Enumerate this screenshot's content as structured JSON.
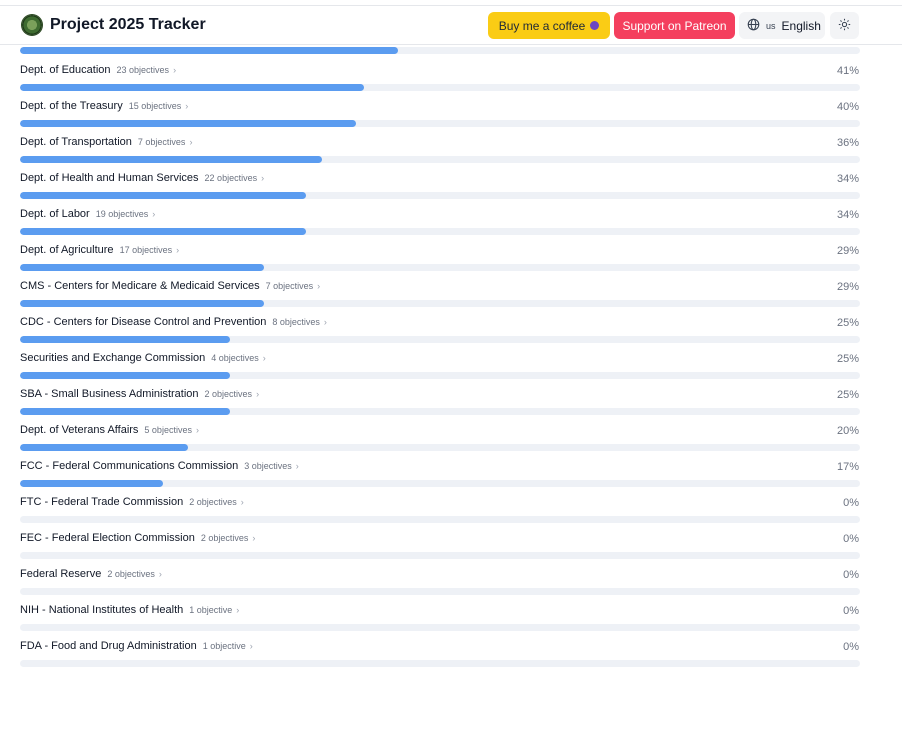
{
  "header": {
    "title": "Project 2025 Tracker",
    "coffee_label": "Buy me a coffee",
    "patreon_label": "Support on Patreon",
    "language_flag": "us",
    "language_label": "English"
  },
  "top_partial_progress": 45,
  "departments": [
    {
      "name": "Dept. of Education",
      "objectives": "23 objectives",
      "percent_label": "41%",
      "percent": 41
    },
    {
      "name": "Dept. of the Treasury",
      "objectives": "15 objectives",
      "percent_label": "40%",
      "percent": 40
    },
    {
      "name": "Dept. of Transportation",
      "objectives": "7 objectives",
      "percent_label": "36%",
      "percent": 36
    },
    {
      "name": "Dept. of Health and Human Services",
      "objectives": "22 objectives",
      "percent_label": "34%",
      "percent": 34
    },
    {
      "name": "Dept. of Labor",
      "objectives": "19 objectives",
      "percent_label": "34%",
      "percent": 34
    },
    {
      "name": "Dept. of Agriculture",
      "objectives": "17 objectives",
      "percent_label": "29%",
      "percent": 29
    },
    {
      "name": "CMS - Centers for Medicare & Medicaid Services",
      "objectives": "7 objectives",
      "percent_label": "29%",
      "percent": 29
    },
    {
      "name": "CDC - Centers for Disease Control and Prevention",
      "objectives": "8 objectives",
      "percent_label": "25%",
      "percent": 25
    },
    {
      "name": "Securities and Exchange Commission",
      "objectives": "4 objectives",
      "percent_label": "25%",
      "percent": 25
    },
    {
      "name": "SBA - Small Business Administration",
      "objectives": "2 objectives",
      "percent_label": "25%",
      "percent": 25
    },
    {
      "name": "Dept. of Veterans Affairs",
      "objectives": "5 objectives",
      "percent_label": "20%",
      "percent": 20
    },
    {
      "name": "FCC - Federal Communications Commission",
      "objectives": "3 objectives",
      "percent_label": "17%",
      "percent": 17
    },
    {
      "name": "FTC - Federal Trade Commission",
      "objectives": "2 objectives",
      "percent_label": "0%",
      "percent": 0
    },
    {
      "name": "FEC - Federal Election Commission",
      "objectives": "2 objectives",
      "percent_label": "0%",
      "percent": 0
    },
    {
      "name": "Federal Reserve",
      "objectives": "2 objectives",
      "percent_label": "0%",
      "percent": 0
    },
    {
      "name": "NIH - National Institutes of Health",
      "objectives": "1 objective",
      "percent_label": "0%",
      "percent": 0
    },
    {
      "name": "FDA - Food and Drug Administration",
      "objectives": "1 objective",
      "percent_label": "0%",
      "percent": 0
    }
  ],
  "icons": {
    "chevron": "chevron-right-icon",
    "globe": "globe-icon",
    "theme": "sun-icon"
  },
  "colors": {
    "progress_fill": "#5b9cf0",
    "progress_track": "#eef1f6",
    "coffee": "#facc15",
    "patreon": "#f43f5e"
  }
}
